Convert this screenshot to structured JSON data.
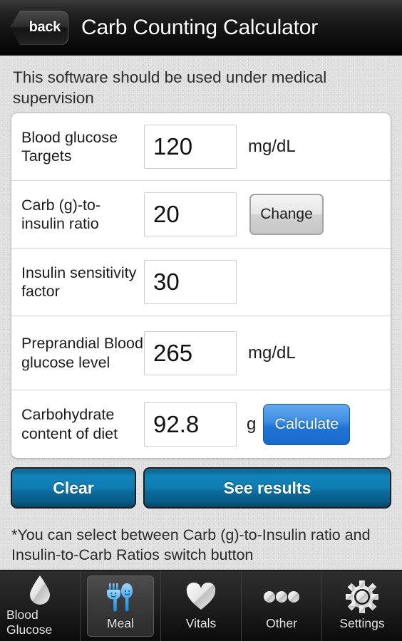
{
  "header": {
    "back_label": "back",
    "title": "Carb Counting Calculator"
  },
  "notice": "This software should be used under medical supervision",
  "form": {
    "rows": [
      {
        "label": "Blood glucose Targets",
        "value": "120",
        "unit": "mg/dL",
        "button": ""
      },
      {
        "label": "Carb (g)-to-insulin ratio",
        "value": "20",
        "unit": "",
        "button": "Change"
      },
      {
        "label": "Insulin sensitivity factor",
        "value": "30",
        "unit": "",
        "button": ""
      },
      {
        "label": "Preprandial Blood glucose level",
        "value": "265",
        "unit": "mg/dL",
        "button": ""
      },
      {
        "label": "Carbohydrate content of diet",
        "value": "92.8",
        "unit": "g",
        "button": "Calculate"
      }
    ]
  },
  "actions": {
    "clear_label": "Clear",
    "results_label": "See results"
  },
  "footnote": "*You can select between Carb (g)-to-Insulin ratio and Insulin-to-Carb Ratios switch button",
  "tabbar": {
    "items": [
      {
        "label": "Blood Glucose",
        "icon": "droplet-icon",
        "selected": false
      },
      {
        "label": "Meal",
        "icon": "fork-knife-icon",
        "selected": true
      },
      {
        "label": "Vitals",
        "icon": "heart-icon",
        "selected": false
      },
      {
        "label": "Other",
        "icon": "three-dots-icon",
        "selected": false
      },
      {
        "label": "Settings",
        "icon": "gear-icon",
        "selected": false
      }
    ]
  },
  "colors": {
    "accent_blue": "#1f73d4",
    "action_teal": "#0e7cb1",
    "meal_icon_blue": "#1b9ae8"
  }
}
